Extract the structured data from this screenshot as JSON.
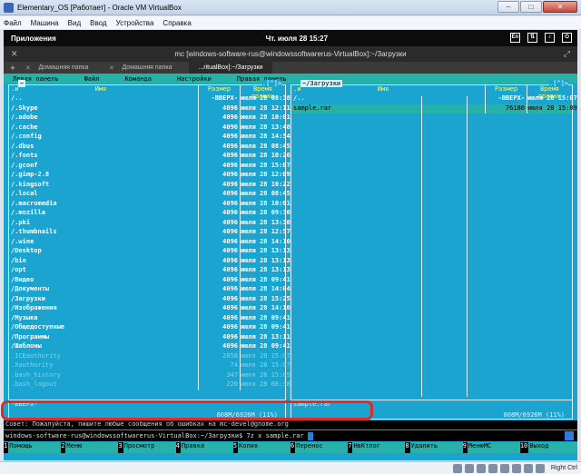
{
  "host": {
    "title": "Elementary_OS [Работает] - Oracle VM VirtualBox",
    "menu": [
      "Файл",
      "Машина",
      "Вид",
      "Ввод",
      "Устройства",
      "Справка"
    ],
    "host_key": "Right Ctrl"
  },
  "guest_panel": {
    "apps": "Приложения",
    "clock": "Чт. июля 28   15:27",
    "tray": [
      "En"
    ]
  },
  "terminal": {
    "title": "mc [windows-software-rus@windowssoftwarerus-VirtualBox]:~/Загрузки",
    "tabs": [
      "Домашняя папка",
      "Домашняя папка",
      "...ritualBox]:~/Загрузки"
    ]
  },
  "mc": {
    "menu": [
      "Левая панель",
      "Файл",
      "Команда",
      "Настройки",
      "Правая панель"
    ],
    "columns": {
      "name": "Имя",
      "size": "Размер",
      "time": "Время правки"
    },
    "left": {
      "path": "~",
      "rows": [
        {
          "n": "/..",
          "s": "-ВВЕРХ-",
          "t": "июля 28 08:38",
          "cls": ""
        },
        {
          "n": "/.Skype",
          "s": "4096",
          "t": "июля 28 12:11",
          "cls": ""
        },
        {
          "n": "/.adobe",
          "s": "4096",
          "t": "июля 28 10:01",
          "cls": ""
        },
        {
          "n": "/.cache",
          "s": "4096",
          "t": "июля 28 13:48",
          "cls": ""
        },
        {
          "n": "/.config",
          "s": "4096",
          "t": "июля 28 14:54",
          "cls": ""
        },
        {
          "n": "/.dbus",
          "s": "4096",
          "t": "июля 28 08:45",
          "cls": ""
        },
        {
          "n": "/.fonts",
          "s": "4096",
          "t": "июля 28 10:26",
          "cls": ""
        },
        {
          "n": "/.gconf",
          "s": "4096",
          "t": "июля 28 15:07",
          "cls": ""
        },
        {
          "n": "/.gimp-2.8",
          "s": "4096",
          "t": "июля 28 12:09",
          "cls": ""
        },
        {
          "n": "/.kingsoft",
          "s": "4096",
          "t": "июля 28 10:22",
          "cls": ""
        },
        {
          "n": "/.local",
          "s": "4096",
          "t": "июля 28 08:45",
          "cls": ""
        },
        {
          "n": "/.macromedia",
          "s": "4096",
          "t": "июля 28 10:01",
          "cls": ""
        },
        {
          "n": "/.mozilla",
          "s": "4096",
          "t": "июля 28 09:30",
          "cls": ""
        },
        {
          "n": "/.pki",
          "s": "4096",
          "t": "июля 28 13:30",
          "cls": ""
        },
        {
          "n": "/.thumbnails",
          "s": "4096",
          "t": "июля 28 12:57",
          "cls": ""
        },
        {
          "n": "/.wine",
          "s": "4096",
          "t": "июля 28 14:10",
          "cls": ""
        },
        {
          "n": "/Desktop",
          "s": "4096",
          "t": "июля 28 13:13",
          "cls": ""
        },
        {
          "n": "/bin",
          "s": "4096",
          "t": "июля 28 13:13",
          "cls": ""
        },
        {
          "n": "/opt",
          "s": "4096",
          "t": "июля 28 13:13",
          "cls": ""
        },
        {
          "n": "/Видео",
          "s": "4096",
          "t": "июля 28 09:41",
          "cls": ""
        },
        {
          "n": "/Документы",
          "s": "4096",
          "t": "июля 28 14:04",
          "cls": ""
        },
        {
          "n": "/Загрузки",
          "s": "4096",
          "t": "июля 28 15:25",
          "cls": ""
        },
        {
          "n": "/Изображения",
          "s": "4096",
          "t": "июля 28 14:10",
          "cls": ""
        },
        {
          "n": "/Музыка",
          "s": "4096",
          "t": "июля 28 09:41",
          "cls": ""
        },
        {
          "n": "/Общедоступные",
          "s": "4096",
          "t": "июля 28 09:41",
          "cls": ""
        },
        {
          "n": "/Программы",
          "s": "4096",
          "t": "июля 28 13:11",
          "cls": ""
        },
        {
          "n": "/Шаблоны",
          "s": "4096",
          "t": "июля 28 09:41",
          "cls": ""
        },
        {
          "n": " .ICEauthority",
          "s": "2058",
          "t": "июля 28 15:07",
          "cls": "dim"
        },
        {
          "n": " .Xauthority",
          "s": "74",
          "t": "июля 28 15:07",
          "cls": "dim"
        },
        {
          "n": " .bash_history",
          "s": "347",
          "t": "июля 28 15:05",
          "cls": "dim"
        },
        {
          "n": " .bash_logout",
          "s": "220",
          "t": "июля 28 08:38",
          "cls": "dim"
        }
      ],
      "footer": "-ВВЕРХ-",
      "usage": "808M/6926M (11%)"
    },
    "right": {
      "path": "~/Загрузки",
      "rows": [
        {
          "n": "/..",
          "s": "-ВВЕРХ-",
          "t": "июля 28 15:07",
          "cls": ""
        },
        {
          "n": " sample.rar",
          "s": "76180",
          "t": "июля 28 15:09",
          "cls": "sel"
        }
      ],
      "footer": "sample.rar",
      "usage": "808M/6926M (11%)"
    },
    "hint": "Совет: Пожалуйста, пишите любые сообщения об ошибках на mc-devel@gnome.org",
    "cmd": "windows-software-rus@windowssoftwarerus-VirtualBox:~/Загрузки$ 7z x sample.rar",
    "fkeys": [
      {
        "num": "1",
        "label": "Помощь"
      },
      {
        "num": "2",
        "label": "Меню"
      },
      {
        "num": "3",
        "label": "Просмотр"
      },
      {
        "num": "4",
        "label": "Правка"
      },
      {
        "num": "5",
        "label": "Копия"
      },
      {
        "num": "6",
        "label": "Перенос"
      },
      {
        "num": "7",
        "label": "НвКтлог"
      },
      {
        "num": "8",
        "label": "Удалить"
      },
      {
        "num": "9",
        "label": "МенюМС"
      },
      {
        "num": "10",
        "label": "Выход"
      }
    ]
  }
}
